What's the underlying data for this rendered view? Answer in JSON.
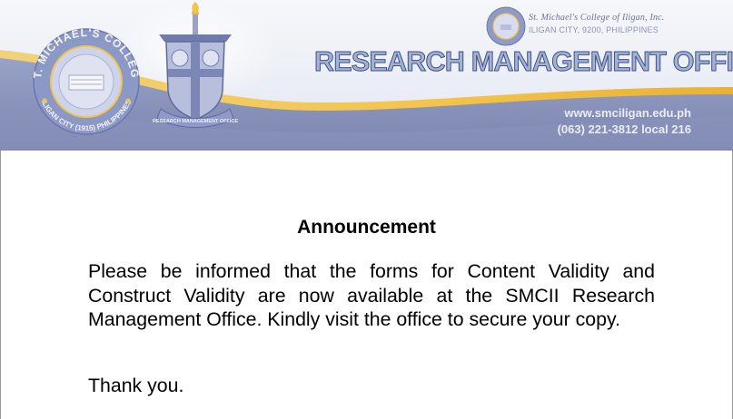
{
  "header": {
    "college_name": "St. Michael's College of Iligan, Inc.",
    "college_address": "ILIGAN CITY, 9200, PHILIPPINES",
    "office_title": "RESEARCH MANAGEMENT OFFICE",
    "website": "www.smciligan.edu.ph",
    "phone": "(063) 221-3812 local 216",
    "seal_ring_top": "ST. MICHAEL'S COLLEGE",
    "seal_ring_bottom": "ILIGAN CITY (1915) PHILIPPINES",
    "emblem_ribbon": "RESEARCH MANAGEMENT OFFICE",
    "colors": {
      "navy": "#3e4f86",
      "swoosh_gold": "#f3c44a",
      "band_blue": "#8d97be"
    }
  },
  "announcement": {
    "title": "Announcement",
    "body": "Please be informed that the forms for Content Validity and Construct Validity are now available at the SMCII Research Management Office. Kindly visit the office to secure your copy.",
    "closing": "Thank you."
  }
}
